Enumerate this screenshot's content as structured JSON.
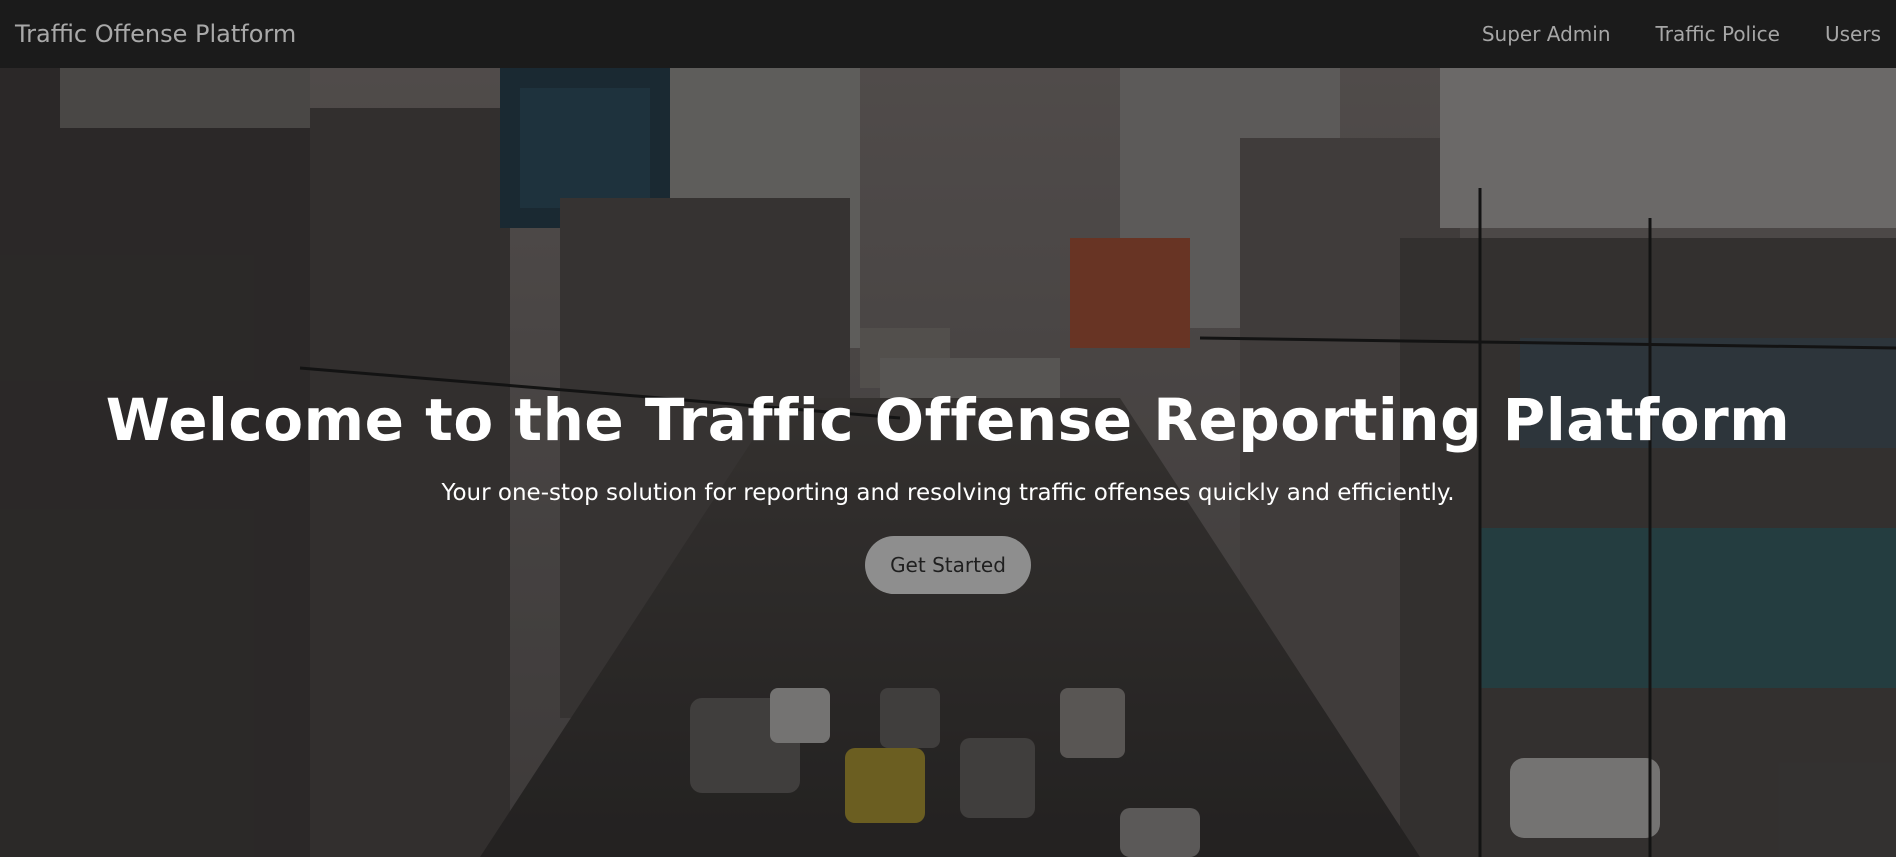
{
  "navbar": {
    "brand": "Traffic Offense Platform",
    "links": [
      "Super Admin",
      "Traffic Police",
      "Users"
    ]
  },
  "hero": {
    "title": "Welcome to the Traffic Offense Reporting Platform",
    "subtitle": "Your one-stop solution for reporting and resolving traffic offenses quickly and efficiently.",
    "cta_label": "Get Started",
    "background_image": "city-traffic-street-photo"
  },
  "colors": {
    "navbar_bg": "#1b1b1b",
    "nav_text": "#a6a6a6",
    "hero_text": "#ffffff",
    "button_bg": "#8e8e8e"
  }
}
